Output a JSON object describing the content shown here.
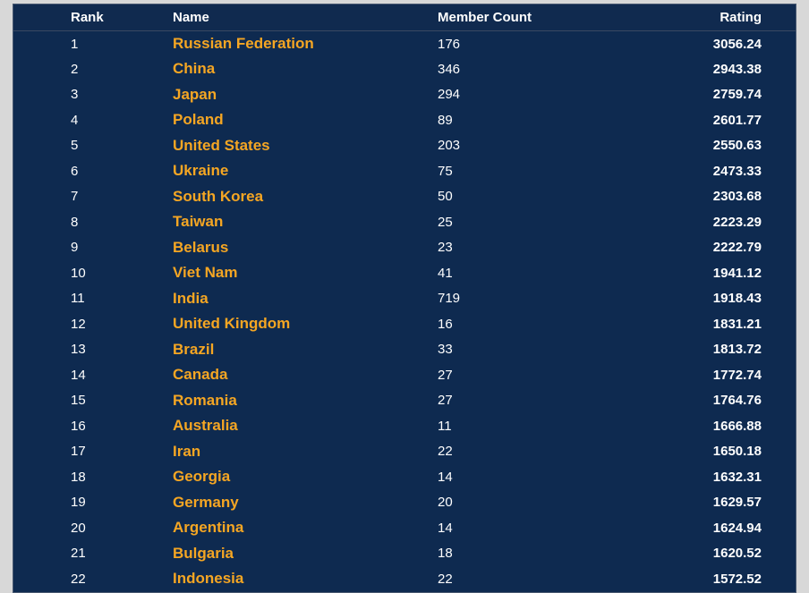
{
  "table": {
    "headers": {
      "rank": "Rank",
      "name": "Name",
      "member_count": "Member Count",
      "rating": "Rating"
    },
    "rows": [
      {
        "rank": "1",
        "name": "Russian Federation",
        "member_count": "176",
        "rating": "3056.24"
      },
      {
        "rank": "2",
        "name": "China",
        "member_count": "346",
        "rating": "2943.38"
      },
      {
        "rank": "3",
        "name": "Japan",
        "member_count": "294",
        "rating": "2759.74"
      },
      {
        "rank": "4",
        "name": "Poland",
        "member_count": "89",
        "rating": "2601.77"
      },
      {
        "rank": "5",
        "name": "United States",
        "member_count": "203",
        "rating": "2550.63"
      },
      {
        "rank": "6",
        "name": "Ukraine",
        "member_count": "75",
        "rating": "2473.33"
      },
      {
        "rank": "7",
        "name": "South Korea",
        "member_count": "50",
        "rating": "2303.68"
      },
      {
        "rank": "8",
        "name": "Taiwan",
        "member_count": "25",
        "rating": "2223.29"
      },
      {
        "rank": "9",
        "name": "Belarus",
        "member_count": "23",
        "rating": "2222.79"
      },
      {
        "rank": "10",
        "name": "Viet Nam",
        "member_count": "41",
        "rating": "1941.12"
      },
      {
        "rank": "11",
        "name": "India",
        "member_count": "719",
        "rating": "1918.43"
      },
      {
        "rank": "12",
        "name": "United Kingdom",
        "member_count": "16",
        "rating": "1831.21"
      },
      {
        "rank": "13",
        "name": "Brazil",
        "member_count": "33",
        "rating": "1813.72"
      },
      {
        "rank": "14",
        "name": "Canada",
        "member_count": "27",
        "rating": "1772.74"
      },
      {
        "rank": "15",
        "name": "Romania",
        "member_count": "27",
        "rating": "1764.76"
      },
      {
        "rank": "16",
        "name": "Australia",
        "member_count": "11",
        "rating": "1666.88"
      },
      {
        "rank": "17",
        "name": "Iran",
        "member_count": "22",
        "rating": "1650.18"
      },
      {
        "rank": "18",
        "name": "Georgia",
        "member_count": "14",
        "rating": "1632.31"
      },
      {
        "rank": "19",
        "name": "Germany",
        "member_count": "20",
        "rating": "1629.57"
      },
      {
        "rank": "20",
        "name": "Argentina",
        "member_count": "14",
        "rating": "1624.94"
      },
      {
        "rank": "21",
        "name": "Bulgaria",
        "member_count": "18",
        "rating": "1620.52"
      },
      {
        "rank": "22",
        "name": "Indonesia",
        "member_count": "22",
        "rating": "1572.52"
      }
    ]
  }
}
